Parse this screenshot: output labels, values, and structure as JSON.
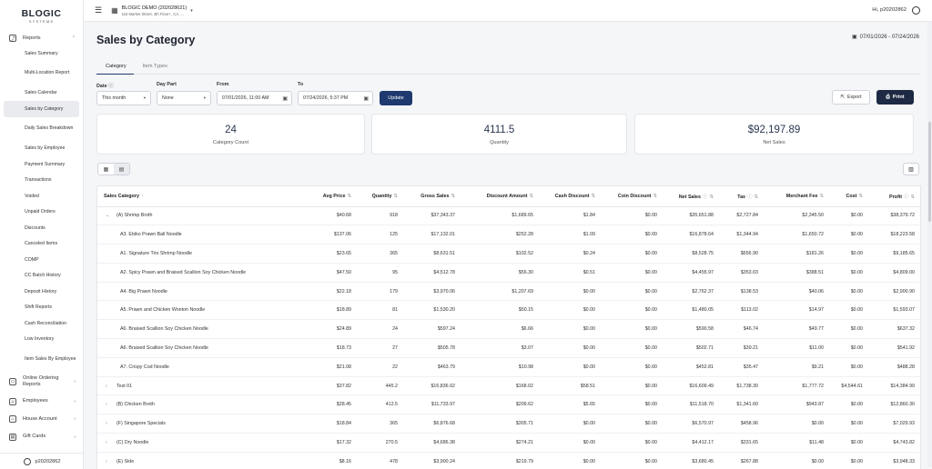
{
  "brand": {
    "name": "BLOGIC",
    "sub": "SYSTEMS"
  },
  "sidebar": {
    "reports_label": "Reports",
    "items": [
      "Sales Summary",
      "Multi-Location Report",
      "Sales Calendar",
      "Sales by Category",
      "Daily Sales Breakdown",
      "Sales by Employee",
      "Payment Summary",
      "Transactions",
      "Voided",
      "Unpaid Orders",
      "Discounts",
      "Canceled Items",
      "COMP",
      "CC Batch History",
      "Deposit History",
      "Shift Reports",
      "Cash Reconciliation",
      "Low Inventory",
      "Item Sales By Employee"
    ],
    "groups": [
      "Online Ordering Reports",
      "Employees",
      "House Account",
      "Gift Cards"
    ],
    "user": "p20202862"
  },
  "header": {
    "store_name": "BLOGIC DEMO (202028621)",
    "store_address": "115 Market Street, 4th Floor+, CA, ...",
    "greeting": "Hi, p20202862"
  },
  "page": {
    "title": "Sales by Category",
    "date_range": "07/01/2026 - 07/24/2026",
    "tabs": [
      "Category",
      "Item Types"
    ],
    "active_tab": "Category"
  },
  "filters": {
    "date_label": "Date",
    "date_value": "This month",
    "daypart_label": "Day Part",
    "daypart_value": "None",
    "from_label": "From",
    "from_value": "07/01/2026, 11:00 AM",
    "to_label": "To",
    "to_value": "07/24/2026, 5:37 PM",
    "update_label": "Update",
    "export_label": "Export",
    "print_label": "Print"
  },
  "stats": [
    {
      "value": "24",
      "label": "Category Count"
    },
    {
      "value": "4111.5",
      "label": "Quantity"
    },
    {
      "value": "$92,197.89",
      "label": "Net Sales"
    }
  ],
  "table": {
    "columns": [
      "Sales Category",
      "Avg Price",
      "Quantity",
      "Gross Sales",
      "Discount Amount",
      "Cash Discount",
      "Coin Discount",
      "Net Sales",
      "Tax",
      "Merchant Fee",
      "Cost",
      "Profit"
    ],
    "rows": [
      {
        "level": "parent",
        "expanded": true,
        "cells": [
          "(A) Shrimp Broth",
          "$40.68",
          "918",
          "$37,343.37",
          "$1,689.65",
          "$1.84",
          "$0.00",
          "$35,651.88",
          "$2,727.84",
          "$2,345.50",
          "$0.00",
          "$38,379.72"
        ]
      },
      {
        "level": "child",
        "cells": [
          "A3. Ebiko Prawn Ball Noodle",
          "$137.06",
          "125",
          "$17,132.01",
          "$252.28",
          "$1.09",
          "$0.00",
          "$16,878.64",
          "$1,344.94",
          "$1,650.72",
          "$0.00",
          "$18,223.58"
        ]
      },
      {
        "level": "child",
        "cells": [
          "A1. Signature Trio Shrimp Noodle",
          "$23.65",
          "365",
          "$8,631.51",
          "$102.52",
          "$0.24",
          "$0.00",
          "$8,528.75",
          "$656.90",
          "$181.26",
          "$0.00",
          "$9,185.65"
        ]
      },
      {
        "level": "child",
        "cells": [
          "A2. Spicy Prawn and Braised Scallion Soy Chicken Noodle",
          "$47.50",
          "95",
          "$4,512.78",
          "$56.30",
          "$0.51",
          "$0.00",
          "$4,455.97",
          "$353.03",
          "$388.51",
          "$0.00",
          "$4,809.00"
        ]
      },
      {
        "level": "child",
        "cells": [
          "A4. Big Prawn Noodle",
          "$22.18",
          "179",
          "$3,970.06",
          "$1,207.69",
          "$0.00",
          "$0.00",
          "$2,762.37",
          "$138.53",
          "$40.06",
          "$0.00",
          "$2,900.90"
        ]
      },
      {
        "level": "child",
        "cells": [
          "A5. Prawn and Chicken Wonton Noodle",
          "$18.89",
          "81",
          "$1,530.20",
          "$50.15",
          "$0.00",
          "$0.00",
          "$1,480.05",
          "$113.02",
          "$14.97",
          "$0.00",
          "$1,593.07"
        ]
      },
      {
        "level": "child",
        "cells": [
          "A6. Braised Scallion Soy Chicken Noodle",
          "$24.89",
          "24",
          "$597.24",
          "$6.66",
          "$0.00",
          "$0.00",
          "$590.58",
          "$46.74",
          "$49.77",
          "$0.00",
          "$637.32"
        ]
      },
      {
        "level": "child",
        "cells": [
          "A6. Braised Scallion Soy Chicken Noodle",
          "$18.73",
          "27",
          "$505.78",
          "$3.07",
          "$0.00",
          "$0.00",
          "$502.71",
          "$39.21",
          "$11.00",
          "$0.00",
          "$541.92"
        ]
      },
      {
        "level": "child",
        "cells": [
          "A7. Crispy Cod Noodle",
          "$21.08",
          "22",
          "$463.79",
          "$10.98",
          "$0.00",
          "$0.00",
          "$452.81",
          "$35.47",
          "$9.21",
          "$0.00",
          "$488.28"
        ]
      },
      {
        "level": "parent",
        "expanded": false,
        "cells": [
          "Test 01",
          "$37.82",
          "445.2",
          "$16,836.02",
          "$168.02",
          "$58.51",
          "$0.00",
          "$16,609.49",
          "$1,738.30",
          "$1,777.72",
          "$4,544.61",
          "$14,384.99"
        ]
      },
      {
        "level": "parent",
        "expanded": false,
        "cells": [
          "(B) Chicken Broth",
          "$28.45",
          "412.5",
          "$11,733.97",
          "$209.62",
          "$5.65",
          "$0.00",
          "$11,518.70",
          "$1,341.60",
          "$943.87",
          "$0.00",
          "$12,860.30"
        ]
      },
      {
        "level": "parent",
        "expanded": false,
        "cells": [
          "(F) Singapore Specials",
          "$18.84",
          "365",
          "$6,876.68",
          "$305.71",
          "$0.00",
          "$0.00",
          "$6,570.97",
          "$458.96",
          "$0.00",
          "$0.00",
          "$7,029.93"
        ]
      },
      {
        "level": "parent",
        "expanded": false,
        "cells": [
          "(C) Dry Noodle",
          "$17.32",
          "270.5",
          "$4,686.38",
          "$274.21",
          "$0.00",
          "$0.00",
          "$4,412.17",
          "$331.65",
          "$11.48",
          "$0.00",
          "$4,743.82"
        ]
      },
      {
        "level": "parent",
        "expanded": false,
        "cells": [
          "(E) Side",
          "$8.16",
          "478",
          "$3,900.24",
          "$219.79",
          "$0.00",
          "$0.00",
          "$3,680.45",
          "$267.88",
          "$0.00",
          "$0.00",
          "$3,948.33"
        ]
      }
    ]
  }
}
